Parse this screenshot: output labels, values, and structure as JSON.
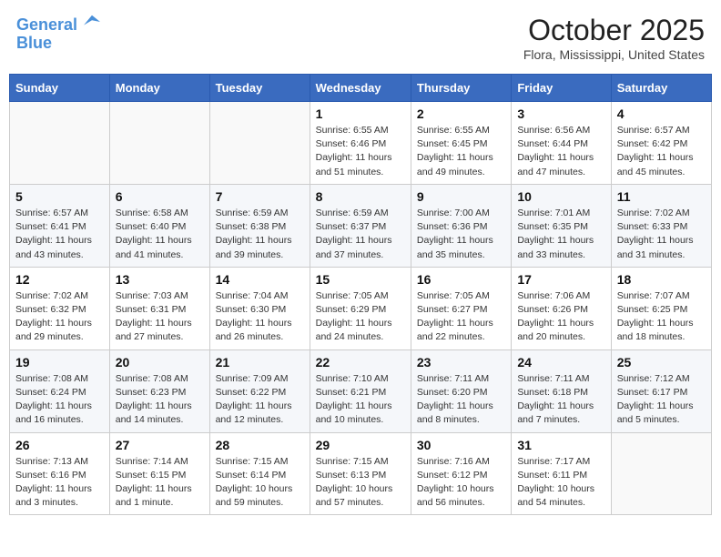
{
  "header": {
    "logo_line1": "General",
    "logo_line2": "Blue",
    "month": "October 2025",
    "location": "Flora, Mississippi, United States"
  },
  "weekdays": [
    "Sunday",
    "Monday",
    "Tuesday",
    "Wednesday",
    "Thursday",
    "Friday",
    "Saturday"
  ],
  "weeks": [
    [
      {
        "day": "",
        "info": ""
      },
      {
        "day": "",
        "info": ""
      },
      {
        "day": "",
        "info": ""
      },
      {
        "day": "1",
        "info": "Sunrise: 6:55 AM\nSunset: 6:46 PM\nDaylight: 11 hours\nand 51 minutes."
      },
      {
        "day": "2",
        "info": "Sunrise: 6:55 AM\nSunset: 6:45 PM\nDaylight: 11 hours\nand 49 minutes."
      },
      {
        "day": "3",
        "info": "Sunrise: 6:56 AM\nSunset: 6:44 PM\nDaylight: 11 hours\nand 47 minutes."
      },
      {
        "day": "4",
        "info": "Sunrise: 6:57 AM\nSunset: 6:42 PM\nDaylight: 11 hours\nand 45 minutes."
      }
    ],
    [
      {
        "day": "5",
        "info": "Sunrise: 6:57 AM\nSunset: 6:41 PM\nDaylight: 11 hours\nand 43 minutes."
      },
      {
        "day": "6",
        "info": "Sunrise: 6:58 AM\nSunset: 6:40 PM\nDaylight: 11 hours\nand 41 minutes."
      },
      {
        "day": "7",
        "info": "Sunrise: 6:59 AM\nSunset: 6:38 PM\nDaylight: 11 hours\nand 39 minutes."
      },
      {
        "day": "8",
        "info": "Sunrise: 6:59 AM\nSunset: 6:37 PM\nDaylight: 11 hours\nand 37 minutes."
      },
      {
        "day": "9",
        "info": "Sunrise: 7:00 AM\nSunset: 6:36 PM\nDaylight: 11 hours\nand 35 minutes."
      },
      {
        "day": "10",
        "info": "Sunrise: 7:01 AM\nSunset: 6:35 PM\nDaylight: 11 hours\nand 33 minutes."
      },
      {
        "day": "11",
        "info": "Sunrise: 7:02 AM\nSunset: 6:33 PM\nDaylight: 11 hours\nand 31 minutes."
      }
    ],
    [
      {
        "day": "12",
        "info": "Sunrise: 7:02 AM\nSunset: 6:32 PM\nDaylight: 11 hours\nand 29 minutes."
      },
      {
        "day": "13",
        "info": "Sunrise: 7:03 AM\nSunset: 6:31 PM\nDaylight: 11 hours\nand 27 minutes."
      },
      {
        "day": "14",
        "info": "Sunrise: 7:04 AM\nSunset: 6:30 PM\nDaylight: 11 hours\nand 26 minutes."
      },
      {
        "day": "15",
        "info": "Sunrise: 7:05 AM\nSunset: 6:29 PM\nDaylight: 11 hours\nand 24 minutes."
      },
      {
        "day": "16",
        "info": "Sunrise: 7:05 AM\nSunset: 6:27 PM\nDaylight: 11 hours\nand 22 minutes."
      },
      {
        "day": "17",
        "info": "Sunrise: 7:06 AM\nSunset: 6:26 PM\nDaylight: 11 hours\nand 20 minutes."
      },
      {
        "day": "18",
        "info": "Sunrise: 7:07 AM\nSunset: 6:25 PM\nDaylight: 11 hours\nand 18 minutes."
      }
    ],
    [
      {
        "day": "19",
        "info": "Sunrise: 7:08 AM\nSunset: 6:24 PM\nDaylight: 11 hours\nand 16 minutes."
      },
      {
        "day": "20",
        "info": "Sunrise: 7:08 AM\nSunset: 6:23 PM\nDaylight: 11 hours\nand 14 minutes."
      },
      {
        "day": "21",
        "info": "Sunrise: 7:09 AM\nSunset: 6:22 PM\nDaylight: 11 hours\nand 12 minutes."
      },
      {
        "day": "22",
        "info": "Sunrise: 7:10 AM\nSunset: 6:21 PM\nDaylight: 11 hours\nand 10 minutes."
      },
      {
        "day": "23",
        "info": "Sunrise: 7:11 AM\nSunset: 6:20 PM\nDaylight: 11 hours\nand 8 minutes."
      },
      {
        "day": "24",
        "info": "Sunrise: 7:11 AM\nSunset: 6:18 PM\nDaylight: 11 hours\nand 7 minutes."
      },
      {
        "day": "25",
        "info": "Sunrise: 7:12 AM\nSunset: 6:17 PM\nDaylight: 11 hours\nand 5 minutes."
      }
    ],
    [
      {
        "day": "26",
        "info": "Sunrise: 7:13 AM\nSunset: 6:16 PM\nDaylight: 11 hours\nand 3 minutes."
      },
      {
        "day": "27",
        "info": "Sunrise: 7:14 AM\nSunset: 6:15 PM\nDaylight: 11 hours\nand 1 minute."
      },
      {
        "day": "28",
        "info": "Sunrise: 7:15 AM\nSunset: 6:14 PM\nDaylight: 10 hours\nand 59 minutes."
      },
      {
        "day": "29",
        "info": "Sunrise: 7:15 AM\nSunset: 6:13 PM\nDaylight: 10 hours\nand 57 minutes."
      },
      {
        "day": "30",
        "info": "Sunrise: 7:16 AM\nSunset: 6:12 PM\nDaylight: 10 hours\nand 56 minutes."
      },
      {
        "day": "31",
        "info": "Sunrise: 7:17 AM\nSunset: 6:11 PM\nDaylight: 10 hours\nand 54 minutes."
      },
      {
        "day": "",
        "info": ""
      }
    ]
  ]
}
